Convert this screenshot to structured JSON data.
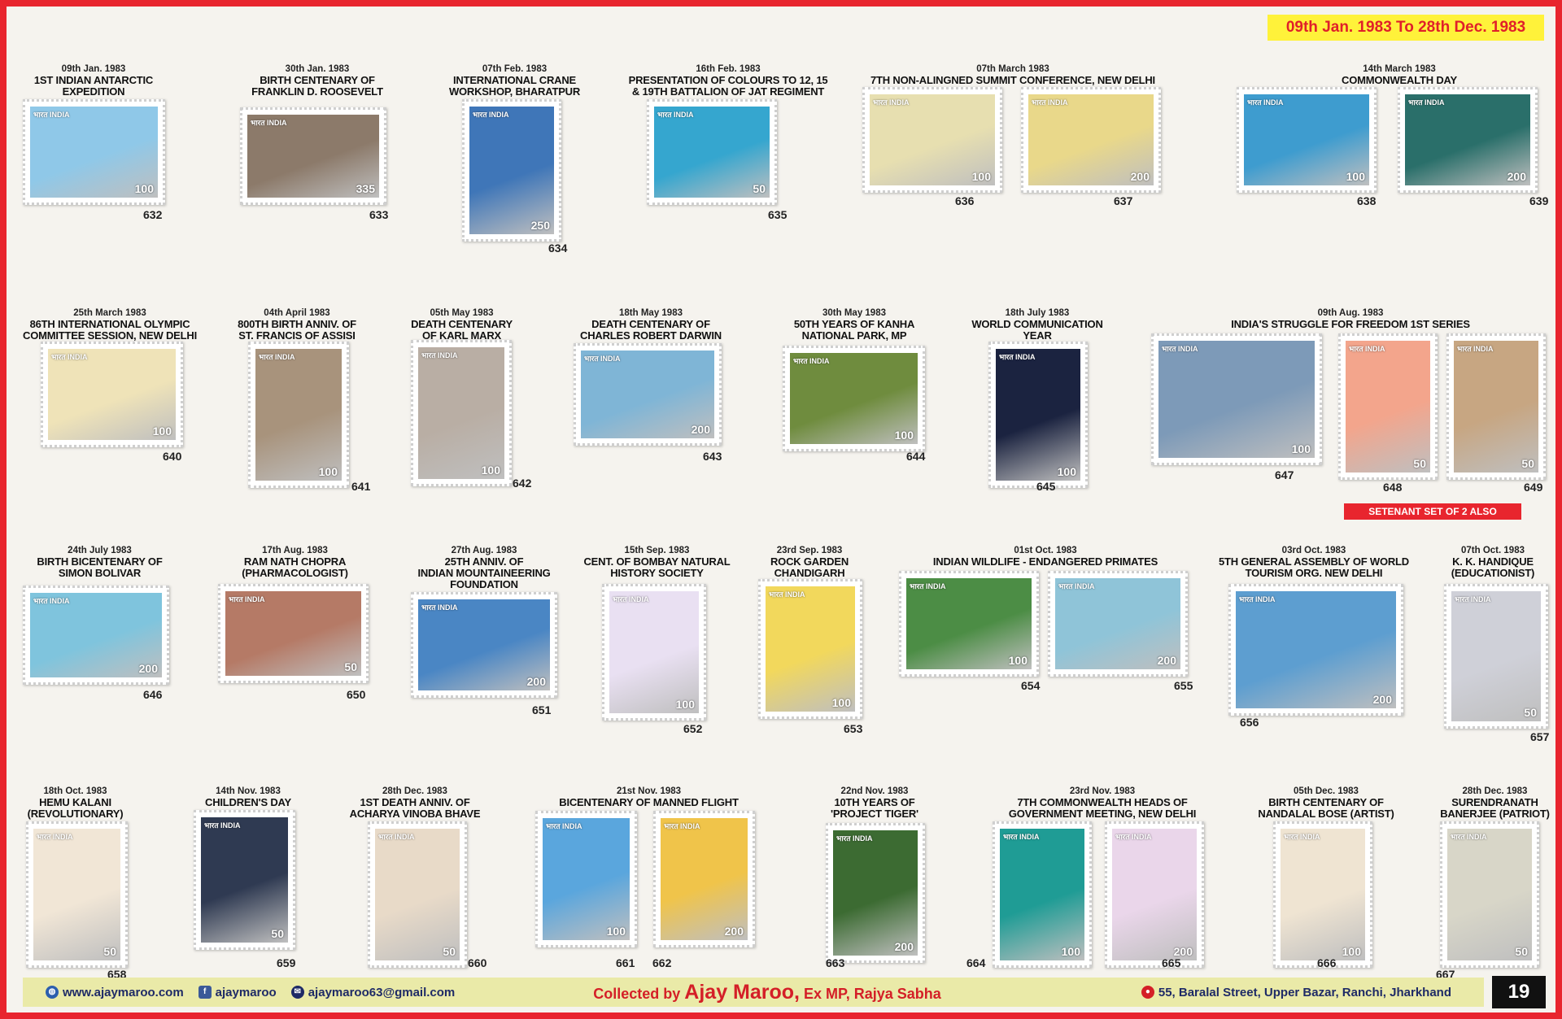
{
  "header": {
    "date_range": "09th Jan. 1983 To 28th Dec. 1983"
  },
  "issues": [
    {
      "date": "09th Jan. 1983",
      "title": "1st INDIAN ANTARCTIC\nEXPEDITION"
    },
    {
      "date": "30th Jan. 1983",
      "title": "BIRTH CENTENARY OF\nFRANKLIN D. ROOSEVELT"
    },
    {
      "date": "07th Feb. 1983",
      "title": "INTERNATIONAL CRANE\nWORKSHOP, BHARATPUR"
    },
    {
      "date": "16th Feb. 1983",
      "title": "PRESENTATION OF COLOURS TO 12, 15\n& 19th BATTALION OF JAT REGIMENT"
    },
    {
      "date": "07th March 1983",
      "title": "7th NON-ALINGNED SUMMIT CONFERENCE, NEW DELHI"
    },
    {
      "date": "14th March 1983",
      "title": "COMMONWEALTH DAY"
    },
    {
      "date": "25th March 1983",
      "title": "86th INTERNATIONAL OLYMPIC\nCOMMITTEE SESSION, NEW DELHI"
    },
    {
      "date": "04th April 1983",
      "title": "800th BIRTH ANNIV. OF\nST. FRANCIS OF ASSISI"
    },
    {
      "date": "05th May 1983",
      "title": "DEATH CENTENARY\nOF KARL MARX"
    },
    {
      "date": "18th May 1983",
      "title": "DEATH CENTENARY OF\nCHARLES ROBERT DARWIN"
    },
    {
      "date": "30th May 1983",
      "title": "50th YEARS OF KANHA\nNATIONAL PARK, MP"
    },
    {
      "date": "18th July 1983",
      "title": "WORLD COMMUNICATION\nYEAR"
    },
    {
      "date": "09th Aug. 1983",
      "title": "INDIA'S STRUGGLE FOR FREEDOM 1st SERIES"
    },
    {
      "date": "24th July 1983",
      "title": "BIRTH BICENTENARY OF\nSIMON BOLIVAR"
    },
    {
      "date": "17th Aug. 1983",
      "title": "RAM NATH CHOPRA\n(PHARMACOLOGIST)"
    },
    {
      "date": "27th Aug. 1983",
      "title": "25th ANNIV. OF\nINDIAN MOUNTAINEERING\nFOUNDATION"
    },
    {
      "date": "15th Sep. 1983",
      "title": "CENT. OF BOMBAY NATURAL\nHISTORY SOCIETY"
    },
    {
      "date": "23rd Sep. 1983",
      "title": "ROCK GARDEN\nCHANDIGARH"
    },
    {
      "date": "01st Oct. 1983",
      "title": "INDIAN WILDLIFE -  ENDANGERED PRIMATES"
    },
    {
      "date": "03rd Oct. 1983",
      "title": "5th GENERAL ASSEMBLY OF WORLD\nTOURISM ORG. NEW DELHI"
    },
    {
      "date": "07th Oct. 1983",
      "title": "K. K. HANDIQUE\n(EDUCATIONIST)"
    },
    {
      "date": "18th Oct. 1983",
      "title": "HEMU KALANI\n(REVOLUTIONARY)"
    },
    {
      "date": "14th Nov. 1983",
      "title": "CHILDREN'S DAY"
    },
    {
      "date": "28th Dec. 1983",
      "title": "1st DEATH ANNIV. OF\nACHARYA VINOBA BHAVE"
    },
    {
      "date": "21st Nov. 1983",
      "title": "BICENTENARY OF MANNED FLIGHT"
    },
    {
      "date": "22nd Nov. 1983",
      "title": "10th YEARS OF\n'PROJECT TIGER'"
    },
    {
      "date": "23rd Nov. 1983",
      "title": "7th COMMONWEALTH HEADS OF\nGOVERNMENT MEETING, NEW DELHI"
    },
    {
      "date": "05th Dec. 1983",
      "title": "BIRTH CENTENARY OF\nNANDALAL BOSE (ARTIST)"
    },
    {
      "date": "28th Dec. 1983",
      "title": "SURENDRANATH\nBANERJEE (PATRIOT)"
    }
  ],
  "stamps": [
    {
      "num": "632",
      "value": "100",
      "label": "भारत INDIA",
      "color": "#8fc8e8"
    },
    {
      "num": "633",
      "value": "335",
      "label": "भारत INDIA",
      "color": "#8c7a6a"
    },
    {
      "num": "634",
      "value": "250",
      "label": "भारत INDIA",
      "color": "#3f76b8"
    },
    {
      "num": "635",
      "value": "50",
      "label": "भारत INDIA",
      "color": "#35a6cf"
    },
    {
      "num": "636",
      "value": "100",
      "label": "भारत INDIA",
      "color": "#e7dfb0"
    },
    {
      "num": "637",
      "value": "200",
      "label": "भारत INDIA",
      "color": "#e9d88a"
    },
    {
      "num": "638",
      "value": "100",
      "label": "भारत INDIA",
      "color": "#3e9ccf"
    },
    {
      "num": "639",
      "value": "200",
      "label": "भारत INDIA",
      "color": "#2a6f6a"
    },
    {
      "num": "640",
      "value": "100",
      "label": "भारत INDIA",
      "color": "#efe3b8"
    },
    {
      "num": "641",
      "value": "100",
      "label": "भारत INDIA",
      "color": "#a8937c"
    },
    {
      "num": "642",
      "value": "100",
      "label": "भारत INDIA",
      "color": "#b9aea4"
    },
    {
      "num": "643",
      "value": "200",
      "label": "भारत INDIA",
      "color": "#7fb5d6"
    },
    {
      "num": "644",
      "value": "100",
      "label": "भारत INDIA",
      "color": "#6f8c3e"
    },
    {
      "num": "645",
      "value": "100",
      "label": "भारत INDIA",
      "color": "#1b2340"
    },
    {
      "num": "647",
      "value": "100",
      "label": "भारत INDIA",
      "color": "#7d9ab8"
    },
    {
      "num": "648",
      "value": "50",
      "label": "भारत INDIA",
      "color": "#f3a58c"
    },
    {
      "num": "649",
      "value": "50",
      "label": "भारत INDIA",
      "color": "#c7a682"
    },
    {
      "num": "646",
      "value": "200",
      "label": "भारत INDIA",
      "color": "#7fc4dd"
    },
    {
      "num": "650",
      "value": "50",
      "label": "भारत INDIA",
      "color": "#b57a66"
    },
    {
      "num": "651",
      "value": "200",
      "label": "भारत INDIA",
      "color": "#4a86c4"
    },
    {
      "num": "652",
      "value": "100",
      "label": "भारत INDIA",
      "color": "#e9e0f2"
    },
    {
      "num": "653",
      "value": "100",
      "label": "भारत INDIA",
      "color": "#f2d85c"
    },
    {
      "num": "654",
      "value": "100",
      "label": "भारत INDIA",
      "color": "#4c8d45"
    },
    {
      "num": "655",
      "value": "200",
      "label": "भारत INDIA",
      "color": "#8fc4d8"
    },
    {
      "num": "656",
      "value": "200",
      "label": "भारत INDIA",
      "color": "#5d9ed0"
    },
    {
      "num": "657",
      "value": "50",
      "label": "भारत INDIA",
      "color": "#cfd0d8"
    },
    {
      "num": "658",
      "value": "50",
      "label": "भारत INDIA",
      "color": "#f1e6d6"
    },
    {
      "num": "659",
      "value": "50",
      "label": "भारत INDIA",
      "color": "#2f3a52"
    },
    {
      "num": "660",
      "value": "50",
      "label": "भारत INDIA",
      "color": "#e8dac8"
    },
    {
      "num": "661",
      "value": "100",
      "label": "भारत INDIA",
      "color": "#5aa6dd"
    },
    {
      "num": "662",
      "value": "200",
      "label": "भारत INDIA",
      "color": "#f0c44a"
    },
    {
      "num": "663",
      "value": "200",
      "label": "भारत INDIA",
      "color": "#3c6b32"
    },
    {
      "num": "664",
      "value": "100",
      "label": "भारत INDIA",
      "color": "#1f9c95"
    },
    {
      "num": "665",
      "value": "200",
      "label": "भारत INDIA",
      "color": "#ead6ea"
    },
    {
      "num": "666",
      "value": "100",
      "label": "भारत INDIA",
      "color": "#efe4d2"
    },
    {
      "num": "667",
      "value": "50",
      "label": "भारत INDIA",
      "color": "#d8d6c8"
    }
  ],
  "setenant": "SETENANT SET OF 2 ALSO",
  "footer": {
    "website": "www.ajaymaroo.com",
    "facebook": "ajaymaroo",
    "email": "ajaymaroo63@gmail.com",
    "collected_prefix": "Collected by ",
    "collector": "Ajay Maroo,",
    "collected_suffix": " Ex MP, Rajya Sabha",
    "address": "55, Baralal Street, Upper Bazar, Ranchi, Jharkhand",
    "page": "19"
  }
}
